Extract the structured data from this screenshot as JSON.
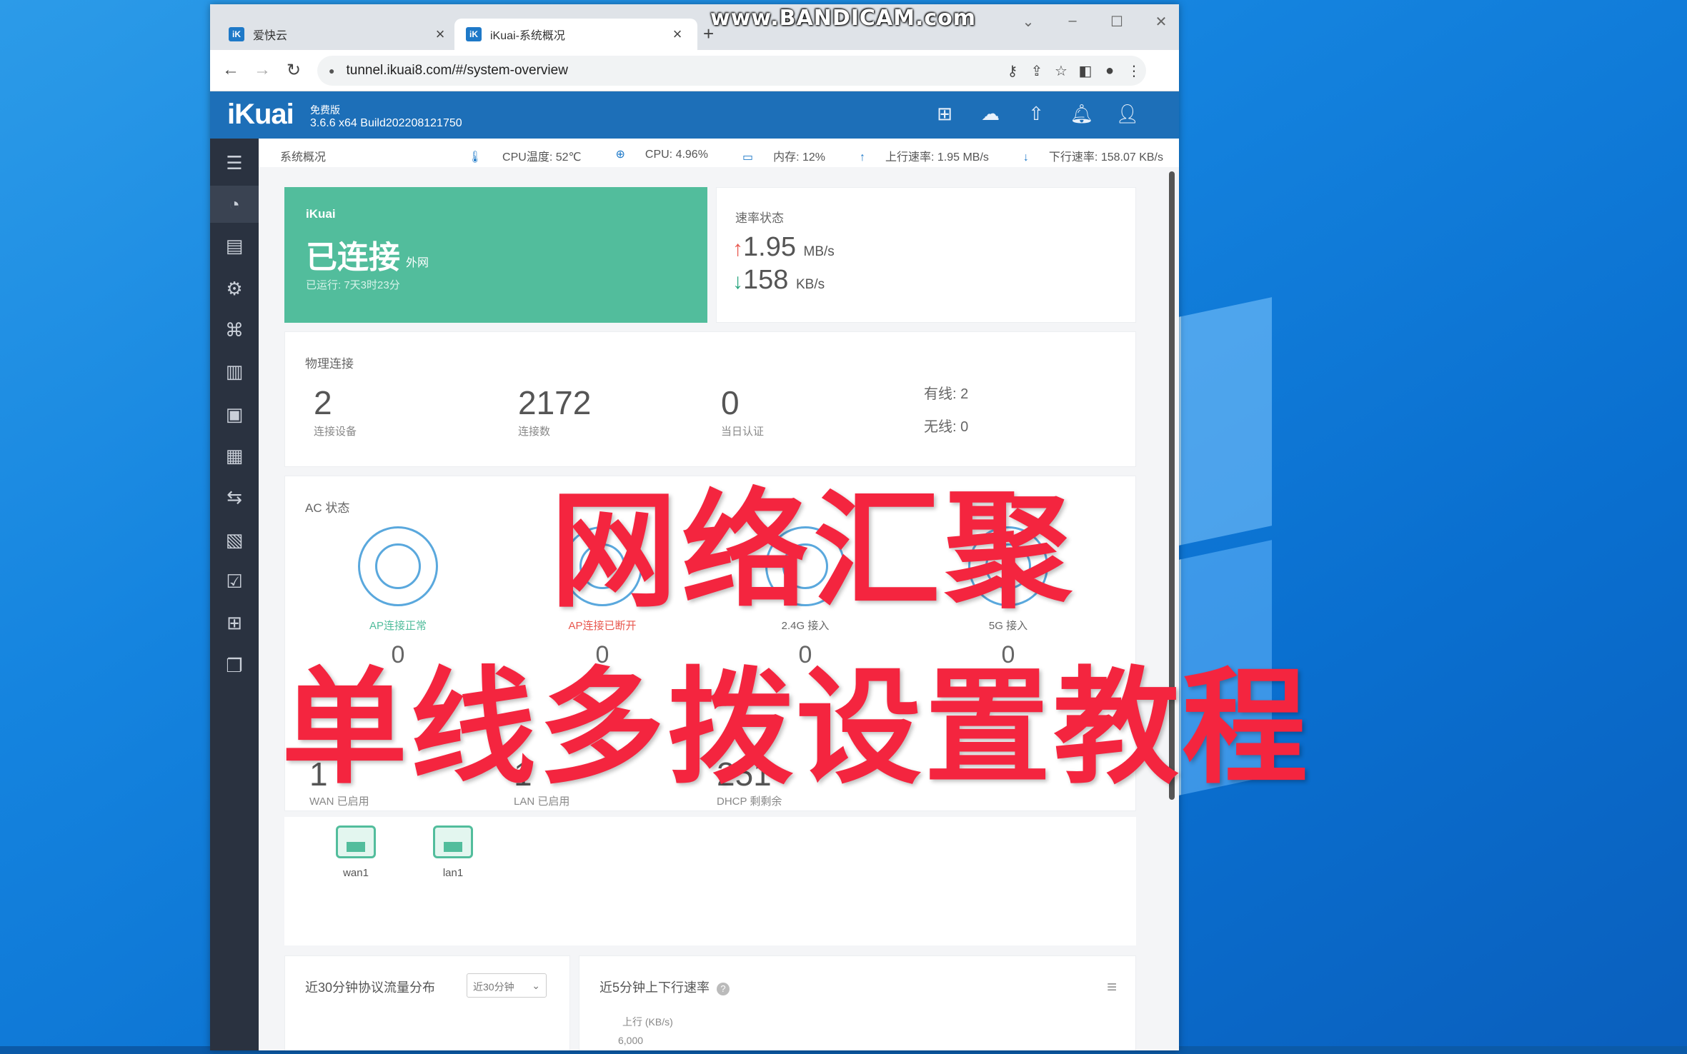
{
  "watermark": "www.BANDICAM.com",
  "browser": {
    "tabs": [
      {
        "label": "爱快云",
        "favicon": "iK"
      },
      {
        "label": "iKuai-系统概况",
        "favicon": "iK"
      }
    ],
    "new_tab": "+",
    "url": "tunnel.ikuai8.com/#/system-overview"
  },
  "ikuai": {
    "logo": "iKuai",
    "edition": "免费版",
    "version": "3.6.6 x64 Build202208121750"
  },
  "statusbar": {
    "title": "系统概况",
    "cpu_temp": "CPU温度: 52℃",
    "cpu": "CPU: 4.96%",
    "memory": "内存: 12%",
    "upload": "上行速率: 1.95 MB/s",
    "download": "下行速率: 158.07 KB/s"
  },
  "connection": {
    "brand": "iKuai",
    "status": "已连接",
    "network": "外网",
    "uptime": "已运行: 7天3时23分"
  },
  "speed": {
    "title": "速率状态",
    "up_value": "1.95",
    "up_unit": "MB/s",
    "down_value": "158",
    "down_unit": "KB/s"
  },
  "physical": {
    "title": "物理连接",
    "stats": [
      {
        "value": "2",
        "label": "连接设备"
      },
      {
        "value": "2172",
        "label": "连接数"
      },
      {
        "value": "0",
        "label": "当日认证"
      }
    ],
    "wired": "有线: 2",
    "wireless": "无线: 0"
  },
  "ac": {
    "title": "AC 状态",
    "items": [
      {
        "label": "AP连接正常",
        "count": "0",
        "color": "#52bd9c"
      },
      {
        "label": "AP连接已断开",
        "count": "0",
        "color": "#e8584f"
      },
      {
        "label": "2.4G 接入",
        "count": "0",
        "color": "#666666"
      },
      {
        "label": "5G 接入",
        "count": "0",
        "color": "#666666"
      }
    ]
  },
  "ports": [
    {
      "value": "1",
      "label": "WAN 已启用"
    },
    {
      "value": "1",
      "label": "LAN 已启用"
    },
    {
      "value": "251",
      "label": "DHCP 剩剩余"
    }
  ],
  "interfaces": [
    {
      "label": "wan1"
    },
    {
      "label": "lan1"
    }
  ],
  "charts": {
    "left_title": "近30分钟协议流量分布",
    "left_select": "近30分钟",
    "right_title": "近5分钟上下行速率",
    "right_axis_title": "上行 (KB/s)",
    "right_tick": "6,000"
  },
  "overlay": {
    "line1": "网络汇聚",
    "line2": "单线多拨设置教程"
  },
  "colors": {
    "header_blue": "#1d6fb8",
    "connected_green": "#52bd9c",
    "overlay_red": "#f4253f",
    "sidebar": "#2a3240"
  }
}
